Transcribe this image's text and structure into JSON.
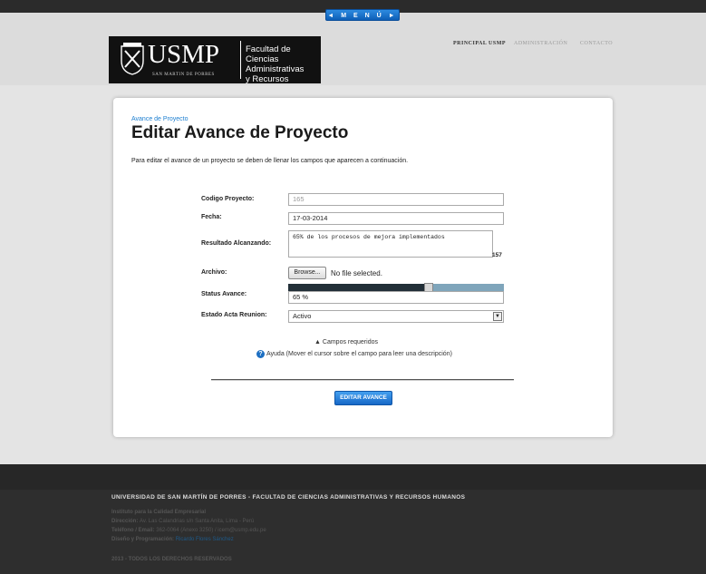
{
  "menu": {
    "label": "◄ M E N Ú ►"
  },
  "header": {
    "logo_text": "USMP",
    "logo_sub": "SAN MARTIN DE PORRES",
    "faculty_lines": [
      "Facultad de",
      "Ciencias Administrativas",
      "y Recursos Humanos"
    ],
    "nav": [
      "PRINCIPAL USMP",
      "ADMINISTRACIÓN",
      "CONTACTO"
    ]
  },
  "form": {
    "breadcrumb": "Avance de Proyecto",
    "title": "Editar Avance de Proyecto",
    "intro": "Para editar el avance de un proyecto se deben de llenar los campos que aparecen a continuación.",
    "fields": {
      "codigo": {
        "label": "Codigo Proyecto:",
        "value": "165"
      },
      "fecha": {
        "label": "Fecha:",
        "value": "17-03-2014"
      },
      "resultado": {
        "label": "Resultado Alcanzando:",
        "value": "65% de los procesos de mejora implementados",
        "count": "157"
      },
      "archivo": {
        "label": "Archivo:",
        "button": "Browse...",
        "status": "No file selected."
      },
      "status": {
        "label": "Status Avance:",
        "value": "65 %",
        "level": 0.65
      },
      "estado": {
        "label": "Estado Acta Reunion:",
        "value": "Activo"
      }
    },
    "required_note": "Campos requeridos",
    "help_note": "Ayuda (Mover el cursor sobre el campo para leer una descripción)",
    "submit_label": "EDITAR AVANCE"
  },
  "footer": {
    "title": "UNIVERSIDAD DE SAN MARTÍN DE PORRES - FACULTAD DE CIENCIAS ADMINISTRATIVAS Y RECURSOS HUMANOS",
    "institute": "Instituto para la Calidad Empresarial",
    "direccion_label": "Dirección:",
    "direccion_value": "Av. Las Calandrias s/n Santa Anita, Lima - Perú",
    "telefono_label": "Teléfono / Email:",
    "telefono_value": "362-0064 (Anexo 3250) / icem@usmp.edu.pe",
    "diseno_label": "Diseño y Programación:",
    "diseno_value": "Ricardo Flores Sánchez",
    "copyright": "2013 - TODOS LOS DERECHOS RESERVADOS"
  },
  "colors": {
    "accent": "#1d7fd0",
    "button": "#1768c7",
    "footer": "#2e2e2e"
  }
}
